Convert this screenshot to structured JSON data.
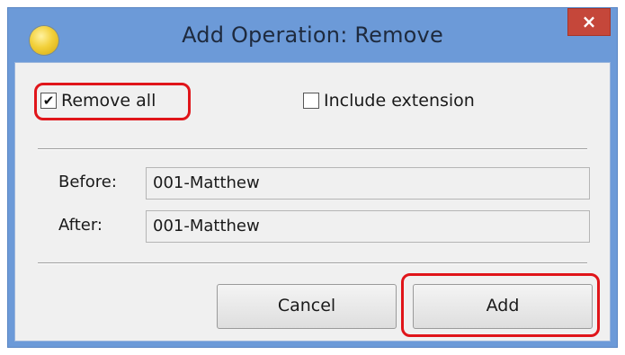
{
  "dialog": {
    "title": "Add Operation: Remove",
    "close_label": "×"
  },
  "options": {
    "remove_all": {
      "label": "Remove all",
      "checked": true,
      "check_glyph": "✔"
    },
    "include_extension": {
      "label": "Include extension",
      "checked": false
    }
  },
  "preview": {
    "before_label": "Before:",
    "before_value": "001-Matthew",
    "after_label": "After:",
    "after_value": "001-Matthew"
  },
  "buttons": {
    "cancel_label": "Cancel",
    "add_label": "Add"
  },
  "colors": {
    "title_bar": "#6c9ad8",
    "close_button": "#c5473a",
    "highlight": "#e0151a"
  },
  "icons": {
    "app": "yellow-circle-icon",
    "close": "close-icon"
  }
}
